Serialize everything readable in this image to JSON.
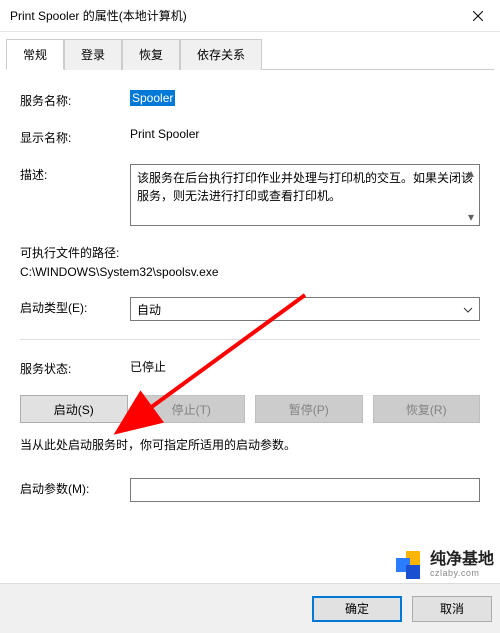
{
  "title": "Print Spooler 的属性(本地计算机)",
  "tabs": {
    "general": "常规",
    "logon": "登录",
    "recovery": "恢复",
    "dependencies": "依存关系"
  },
  "labels": {
    "service_name": "服务名称:",
    "display_name": "显示名称:",
    "description": "描述:",
    "exe_path": "可执行文件的路径:",
    "startup_type": "启动类型(E):",
    "service_status": "服务状态:",
    "hint": "当从此处启动服务时，你可指定所适用的启动参数。",
    "start_params": "启动参数(M):"
  },
  "values": {
    "service_name": "Spooler",
    "display_name": "Print Spooler",
    "description": "该服务在后台执行打印作业并处理与打印机的交互。如果关闭该服务，则无法进行打印或查看打印机。",
    "exe_path": "C:\\WINDOWS\\System32\\spoolsv.exe",
    "startup_type": "自动",
    "service_status": "已停止",
    "start_params": ""
  },
  "buttons": {
    "start": "启动(S)",
    "stop": "停止(T)",
    "pause": "暂停(P)",
    "resume": "恢复(R)",
    "ok": "确定",
    "cancel": "取消"
  },
  "watermark": {
    "cn": "纯净基地",
    "en": "czlaby.com"
  }
}
